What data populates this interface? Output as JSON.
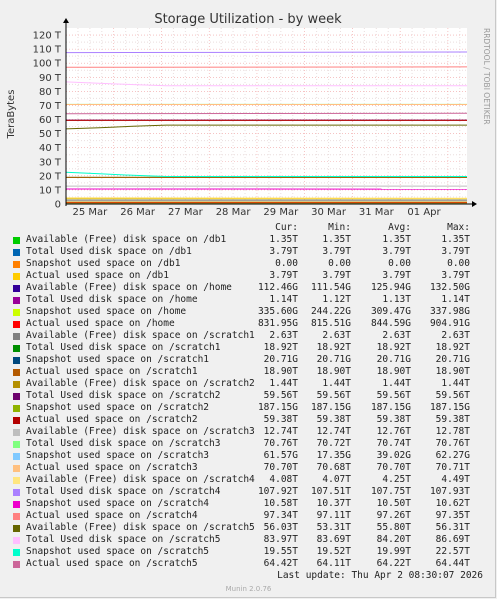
{
  "chart_data": {
    "type": "line",
    "title": "Storage Utilization - by week",
    "ylabel": "TeraBytes",
    "ylim": [
      0,
      125
    ],
    "y_ticks": [
      0,
      10,
      20,
      30,
      40,
      50,
      60,
      70,
      80,
      90,
      100,
      110,
      120
    ],
    "y_tick_labels": [
      "0",
      "10 T",
      "20 T",
      "30 T",
      "40 T",
      "50 T",
      "60 T",
      "70 T",
      "80 T",
      "90 T",
      "100 T",
      "110 T",
      "120 T"
    ],
    "x_tick_labels": [
      "25 Mar",
      "26 Mar",
      "27 Mar",
      "28 Mar",
      "29 Mar",
      "30 Mar",
      "31 Mar",
      "01 Apr"
    ],
    "x_range_days": [
      0,
      8.4
    ],
    "grid": true,
    "series": [
      {
        "name": "Available (Free) disk space on /db1",
        "color": "#00cc00",
        "x": [
          0,
          8.4
        ],
        "values": [
          1.35,
          1.35
        ]
      },
      {
        "name": "Total Used disk space on /db1",
        "color": "#0066b3",
        "x": [
          0,
          8.4
        ],
        "values": [
          3.79,
          3.79
        ]
      },
      {
        "name": "Snapshot used space on /db1",
        "color": "#ff8000",
        "x": [
          0,
          8.4
        ],
        "values": [
          0.0,
          0.0
        ]
      },
      {
        "name": "Actual used space on /db1",
        "color": "#ffcc00",
        "x": [
          0,
          8.4
        ],
        "values": [
          3.79,
          3.79
        ]
      },
      {
        "name": "Available (Free) disk space on /home",
        "color": "#330099",
        "x": [
          0,
          8.4
        ],
        "values": [
          0.13,
          0.13
        ]
      },
      {
        "name": "Total Used disk space on /home",
        "color": "#990099",
        "x": [
          0,
          8.4
        ],
        "values": [
          1.14,
          1.14
        ]
      },
      {
        "name": "Snapshot used space on /home",
        "color": "#ccff00",
        "x": [
          0,
          8.4
        ],
        "values": [
          0.34,
          0.34
        ]
      },
      {
        "name": "Actual used space on /home",
        "color": "#ff0000",
        "x": [
          0,
          8.4
        ],
        "values": [
          0.84,
          0.83
        ]
      },
      {
        "name": "Available (Free) disk space on /scratch1",
        "color": "#808080",
        "x": [
          0,
          8.4
        ],
        "values": [
          2.63,
          2.63
        ]
      },
      {
        "name": "Total Used disk space on /scratch1",
        "color": "#008f00",
        "x": [
          0,
          8.4
        ],
        "values": [
          18.92,
          18.92
        ]
      },
      {
        "name": "Snapshot used space on /scratch1",
        "color": "#00487d",
        "x": [
          0,
          8.4
        ],
        "values": [
          0.02,
          0.02
        ]
      },
      {
        "name": "Actual used space on /scratch1",
        "color": "#b35a00",
        "x": [
          0,
          8.4
        ],
        "values": [
          18.9,
          18.9
        ]
      },
      {
        "name": "Available (Free) disk space on /scratch2",
        "color": "#b38f00",
        "x": [
          0,
          8.4
        ],
        "values": [
          1.44,
          1.44
        ]
      },
      {
        "name": "Total Used disk space on /scratch2",
        "color": "#6b006b",
        "x": [
          0,
          8.4
        ],
        "values": [
          59.56,
          59.56
        ]
      },
      {
        "name": "Snapshot used space on /scratch2",
        "color": "#8fb300",
        "x": [
          0,
          8.4
        ],
        "values": [
          0.19,
          0.19
        ]
      },
      {
        "name": "Actual used space on /scratch2",
        "color": "#b30000",
        "x": [
          0,
          8.4
        ],
        "values": [
          59.38,
          59.38
        ]
      },
      {
        "name": "Available (Free) disk space on /scratch3",
        "color": "#bebebe",
        "x": [
          0,
          8.4
        ],
        "values": [
          12.74,
          12.74
        ]
      },
      {
        "name": "Total Used disk space on /scratch3",
        "color": "#80ff80",
        "x": [
          0,
          8.4
        ],
        "values": [
          70.72,
          70.76
        ]
      },
      {
        "name": "Snapshot used space on /scratch3",
        "color": "#80c9ff",
        "x": [
          0,
          8.4
        ],
        "values": [
          0.06,
          0.06
        ]
      },
      {
        "name": "Actual used space on /scratch3",
        "color": "#ffc080",
        "x": [
          0,
          8.4
        ],
        "values": [
          70.68,
          70.7
        ]
      },
      {
        "name": "Available (Free) disk space on /scratch4",
        "color": "#ffe680",
        "x": [
          0,
          8.4
        ],
        "values": [
          4.49,
          4.08
        ]
      },
      {
        "name": "Total Used disk space on /scratch4",
        "color": "#aa80ff",
        "x": [
          0,
          8.4
        ],
        "values": [
          107.51,
          107.92
        ]
      },
      {
        "name": "Snapshot used space on /scratch4",
        "color": "#ee00cc",
        "x": [
          0,
          8.4
        ],
        "values": [
          10.62,
          10.58
        ]
      },
      {
        "name": "Actual used space on /scratch4",
        "color": "#ff8080",
        "x": [
          0,
          8.4
        ],
        "values": [
          97.11,
          97.34
        ]
      },
      {
        "name": "Available (Free) disk space on /scratch5",
        "color": "#666600",
        "x": [
          0,
          0.7,
          1.4,
          2.1,
          8.4
        ],
        "values": [
          53.31,
          54.2,
          55.2,
          56.03,
          56.03
        ]
      },
      {
        "name": "Total Used disk space on /scratch5",
        "color": "#ffbfff",
        "x": [
          0,
          1.0,
          2.1,
          8.4
        ],
        "values": [
          86.69,
          85.3,
          83.97,
          83.97
        ]
      },
      {
        "name": "Snapshot used space on /scratch5",
        "color": "#00ffcc",
        "x": [
          0,
          0.7,
          1.4,
          2.1,
          8.4
        ],
        "values": [
          22.57,
          21.5,
          20.4,
          19.55,
          19.55
        ]
      },
      {
        "name": "Actual used space on /scratch5",
        "color": "#cc6699",
        "x": [
          0,
          8.4
        ],
        "values": [
          64.11,
          64.42
        ]
      }
    ]
  },
  "legend": {
    "header": {
      "cur": "Cur:",
      "min": "Min:",
      "avg": "Avg:",
      "max": "Max:"
    },
    "rows": [
      {
        "label": "Available (Free) disk space on /db1",
        "color": "#00cc00",
        "cur": "1.35T",
        "min": "1.35T",
        "avg": "1.35T",
        "max": "1.35T"
      },
      {
        "label": "Total Used disk space on /db1",
        "color": "#0066b3",
        "cur": "3.79T",
        "min": "3.79T",
        "avg": "3.79T",
        "max": "3.79T"
      },
      {
        "label": "Snapshot used space on /db1",
        "color": "#ff8000",
        "cur": "0.00",
        "min": "0.00",
        "avg": "0.00",
        "max": "0.00"
      },
      {
        "label": "Actual used space on /db1",
        "color": "#ffcc00",
        "cur": "3.79T",
        "min": "3.79T",
        "avg": "3.79T",
        "max": "3.79T"
      },
      {
        "label": "Available (Free) disk space on /home",
        "color": "#330099",
        "cur": "112.46G",
        "min": "111.54G",
        "avg": "125.94G",
        "max": "132.50G"
      },
      {
        "label": "Total Used disk space on /home",
        "color": "#990099",
        "cur": "1.14T",
        "min": "1.12T",
        "avg": "1.13T",
        "max": "1.14T"
      },
      {
        "label": "Snapshot used space on /home",
        "color": "#ccff00",
        "cur": "335.60G",
        "min": "244.22G",
        "avg": "309.47G",
        "max": "337.98G"
      },
      {
        "label": "Actual used space on /home",
        "color": "#ff0000",
        "cur": "831.95G",
        "min": "815.51G",
        "avg": "844.59G",
        "max": "904.91G"
      },
      {
        "label": "Available (Free) disk space on /scratch1",
        "color": "#808080",
        "cur": "2.63T",
        "min": "2.63T",
        "avg": "2.63T",
        "max": "2.63T"
      },
      {
        "label": "Total Used disk space on /scratch1",
        "color": "#008f00",
        "cur": "18.92T",
        "min": "18.92T",
        "avg": "18.92T",
        "max": "18.92T"
      },
      {
        "label": "Snapshot used space on /scratch1",
        "color": "#00487d",
        "cur": "20.71G",
        "min": "20.71G",
        "avg": "20.71G",
        "max": "20.71G"
      },
      {
        "label": "Actual used space on /scratch1",
        "color": "#b35a00",
        "cur": "18.90T",
        "min": "18.90T",
        "avg": "18.90T",
        "max": "18.90T"
      },
      {
        "label": "Available (Free) disk space on /scratch2",
        "color": "#b38f00",
        "cur": "1.44T",
        "min": "1.44T",
        "avg": "1.44T",
        "max": "1.44T"
      },
      {
        "label": "Total Used disk space on /scratch2",
        "color": "#6b006b",
        "cur": "59.56T",
        "min": "59.56T",
        "avg": "59.56T",
        "max": "59.56T"
      },
      {
        "label": "Snapshot used space on /scratch2",
        "color": "#8fb300",
        "cur": "187.15G",
        "min": "187.15G",
        "avg": "187.15G",
        "max": "187.15G"
      },
      {
        "label": "Actual used space on /scratch2",
        "color": "#b30000",
        "cur": "59.38T",
        "min": "59.38T",
        "avg": "59.38T",
        "max": "59.38T"
      },
      {
        "label": "Available (Free) disk space on /scratch3",
        "color": "#bebebe",
        "cur": "12.74T",
        "min": "12.74T",
        "avg": "12.76T",
        "max": "12.78T"
      },
      {
        "label": "Total Used disk space on /scratch3",
        "color": "#80ff80",
        "cur": "70.76T",
        "min": "70.72T",
        "avg": "70.74T",
        "max": "70.76T"
      },
      {
        "label": "Snapshot used space on /scratch3",
        "color": "#80c9ff",
        "cur": "61.57G",
        "min": "17.35G",
        "avg": "39.02G",
        "max": "62.27G"
      },
      {
        "label": "Actual used space on /scratch3",
        "color": "#ffc080",
        "cur": "70.70T",
        "min": "70.68T",
        "avg": "70.70T",
        "max": "70.71T"
      },
      {
        "label": "Available (Free) disk space on /scratch4",
        "color": "#ffe680",
        "cur": "4.08T",
        "min": "4.07T",
        "avg": "4.25T",
        "max": "4.49T"
      },
      {
        "label": "Total Used disk space on /scratch4",
        "color": "#aa80ff",
        "cur": "107.92T",
        "min": "107.51T",
        "avg": "107.75T",
        "max": "107.93T"
      },
      {
        "label": "Snapshot used space on /scratch4",
        "color": "#ee00cc",
        "cur": "10.58T",
        "min": "10.37T",
        "avg": "10.50T",
        "max": "10.62T"
      },
      {
        "label": "Actual used space on /scratch4",
        "color": "#ff8080",
        "cur": "97.34T",
        "min": "97.11T",
        "avg": "97.26T",
        "max": "97.35T"
      },
      {
        "label": "Available (Free) disk space on /scratch5",
        "color": "#666600",
        "cur": "56.03T",
        "min": "53.31T",
        "avg": "55.80T",
        "max": "56.31T"
      },
      {
        "label": "Total Used disk space on /scratch5",
        "color": "#ffbfff",
        "cur": "83.97T",
        "min": "83.69T",
        "avg": "84.20T",
        "max": "86.69T"
      },
      {
        "label": "Snapshot used space on /scratch5",
        "color": "#00ffcc",
        "cur": "19.55T",
        "min": "19.52T",
        "avg": "19.99T",
        "max": "22.57T"
      },
      {
        "label": "Actual used space on /scratch5",
        "color": "#cc6699",
        "cur": "64.42T",
        "min": "64.11T",
        "avg": "64.22T",
        "max": "64.44T"
      }
    ]
  },
  "footer": {
    "last_update": "Last update: Thu Apr  2 08:30:07 2026",
    "munin_version": "Munin 2.0.76"
  },
  "side_label": "RRDTOOL / TOBI OETIKER"
}
